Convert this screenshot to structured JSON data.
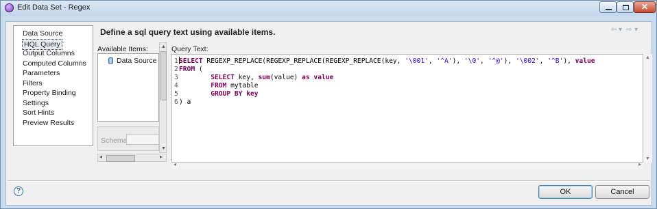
{
  "window": {
    "title": "Edit Data Set - Regex",
    "close_glyph": "✕"
  },
  "nav": {
    "items": [
      {
        "label": "Data Source"
      },
      {
        "label": "HQL Query"
      },
      {
        "label": "Output Columns"
      },
      {
        "label": "Computed Columns"
      },
      {
        "label": "Parameters"
      },
      {
        "label": "Filters"
      },
      {
        "label": "Property Binding"
      },
      {
        "label": "Settings"
      },
      {
        "label": "Sort Hints"
      },
      {
        "label": "Preview Results"
      }
    ],
    "selected": "HQL Query"
  },
  "page": {
    "title": "Define a sql query text using available items."
  },
  "history": {
    "back_glyph": "⇦",
    "forward_glyph": "⇨",
    "menu_glyph": "▾"
  },
  "available": {
    "label": "Available Items:",
    "items": [
      {
        "label": "Data Source",
        "icon": "database-icon"
      }
    ],
    "schema_label": "Schema:"
  },
  "query": {
    "label": "Query Text:",
    "lines": [
      {
        "n": "1",
        "segments": [
          {
            "t": "SELECT",
            "k": "kw"
          },
          {
            "t": " REGEXP_REPLACE(REGEXP_REPLACE(REGEXP_REPLACE(key, ",
            "k": ""
          },
          {
            "t": "'\\001'",
            "k": "st"
          },
          {
            "t": ", ",
            "k": ""
          },
          {
            "t": "'^A'",
            "k": "st"
          },
          {
            "t": "), ",
            "k": ""
          },
          {
            "t": "'\\0'",
            "k": "st"
          },
          {
            "t": ", ",
            "k": ""
          },
          {
            "t": "'^@'",
            "k": "st"
          },
          {
            "t": "), ",
            "k": ""
          },
          {
            "t": "'\\002'",
            "k": "st"
          },
          {
            "t": ", ",
            "k": ""
          },
          {
            "t": "'^B'",
            "k": "st"
          },
          {
            "t": "), ",
            "k": ""
          },
          {
            "t": "value",
            "k": "kw"
          }
        ]
      },
      {
        "n": "2",
        "segments": [
          {
            "t": "FROM",
            "k": "kw"
          },
          {
            "t": " (",
            "k": ""
          }
        ]
      },
      {
        "n": "3",
        "segments": [
          {
            "t": "        ",
            "k": ""
          },
          {
            "t": "SELECT",
            "k": "kw"
          },
          {
            "t": " key, ",
            "k": ""
          },
          {
            "t": "sum",
            "k": "kw"
          },
          {
            "t": "(value) ",
            "k": ""
          },
          {
            "t": "as",
            "k": "kw"
          },
          {
            "t": " ",
            "k": ""
          },
          {
            "t": "value",
            "k": "kw"
          }
        ]
      },
      {
        "n": "4",
        "segments": [
          {
            "t": "        ",
            "k": ""
          },
          {
            "t": "FROM",
            "k": "kw"
          },
          {
            "t": " mytable",
            "k": ""
          }
        ]
      },
      {
        "n": "5",
        "segments": [
          {
            "t": "        ",
            "k": ""
          },
          {
            "t": "GROUP BY",
            "k": "kw"
          },
          {
            "t": " ",
            "k": ""
          },
          {
            "t": "key",
            "k": "kw"
          }
        ]
      },
      {
        "n": "6",
        "segments": [
          {
            "t": ") a",
            "k": ""
          }
        ]
      }
    ]
  },
  "footer": {
    "help_glyph": "?",
    "ok_label": "OK",
    "cancel_label": "Cancel"
  }
}
